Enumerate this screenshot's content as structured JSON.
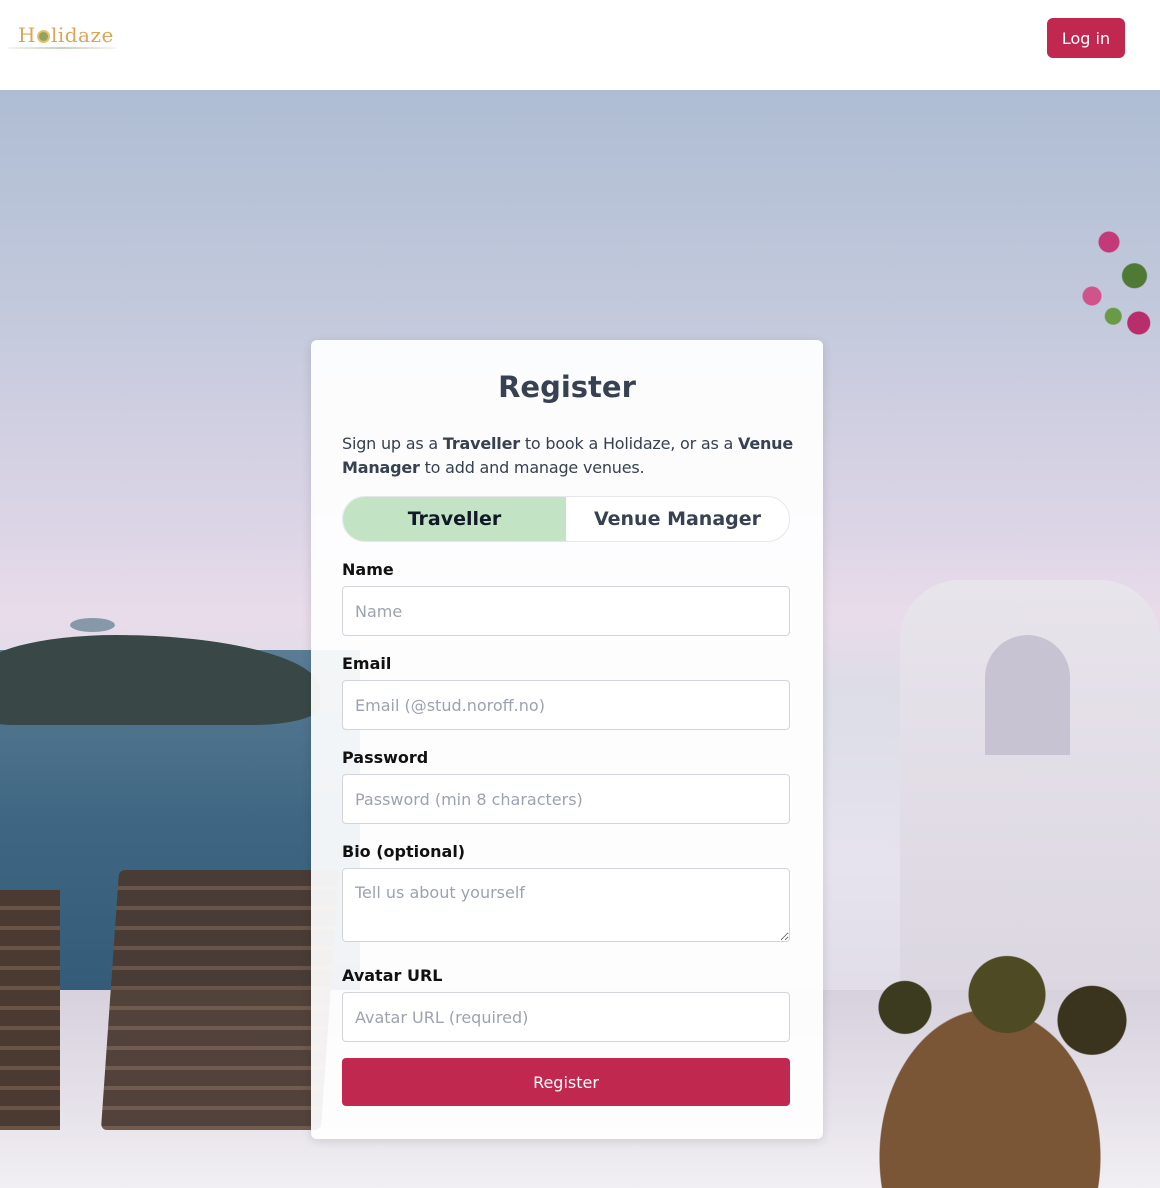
{
  "header": {
    "logo_text": "Holidaze",
    "login_label": "Log in"
  },
  "register": {
    "title": "Register",
    "intro": {
      "part1": "Sign up as a ",
      "traveller": "Traveller",
      "part2": " to book a Holidaze, or as a ",
      "venue_manager": "Venue Manager",
      "part3": " to add and manage venues."
    },
    "toggle": {
      "options": [
        "Traveller",
        "Venue Manager"
      ],
      "selected": "Traveller"
    },
    "fields": {
      "name": {
        "label": "Name",
        "placeholder": "Name",
        "value": ""
      },
      "email": {
        "label": "Email",
        "placeholder": "Email (@stud.noroff.no)",
        "value": ""
      },
      "password": {
        "label": "Password",
        "placeholder": "Password (min 8 characters)",
        "value": ""
      },
      "bio": {
        "label": "Bio (optional)",
        "placeholder": "Tell us about yourself",
        "value": ""
      },
      "avatar": {
        "label": "Avatar URL",
        "placeholder": "Avatar URL (required)",
        "value": ""
      }
    },
    "submit_label": "Register"
  },
  "colors": {
    "accent": "#c0284f",
    "toggle_active": "#c3e3c5",
    "logo": "#d8a657"
  }
}
